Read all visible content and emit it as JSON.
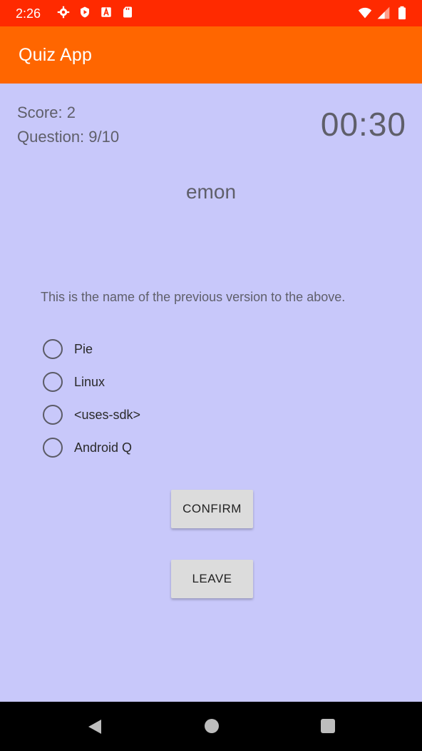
{
  "status_bar": {
    "time": "2:26",
    "icons": [
      "settings-icon",
      "shield-icon",
      "a-icon",
      "sd-card-icon"
    ],
    "right_icons": [
      "wifi-icon",
      "signal-icon",
      "battery-icon"
    ]
  },
  "app_bar": {
    "title": "Quiz App"
  },
  "quiz": {
    "score": "Score: 2",
    "question_counter": "Question: 9/10",
    "timer": "00:30",
    "word": "emon",
    "question_text": "This is the name of the previous version to the above.",
    "options": [
      {
        "label": "Pie",
        "selected": false
      },
      {
        "label": "Linux",
        "selected": false
      },
      {
        "label": "<uses-sdk>",
        "selected": false
      },
      {
        "label": "Android Q",
        "selected": false
      }
    ],
    "confirm_label": "CONFIRM",
    "leave_label": "LEAVE"
  },
  "nav_bar": {
    "icons": [
      "back-icon",
      "home-icon",
      "recents-icon"
    ]
  },
  "colors": {
    "status_bar": "#FF2A00",
    "app_bar": "#FF6600",
    "background": "#C8C8FA",
    "button": "#DCDCDC"
  }
}
